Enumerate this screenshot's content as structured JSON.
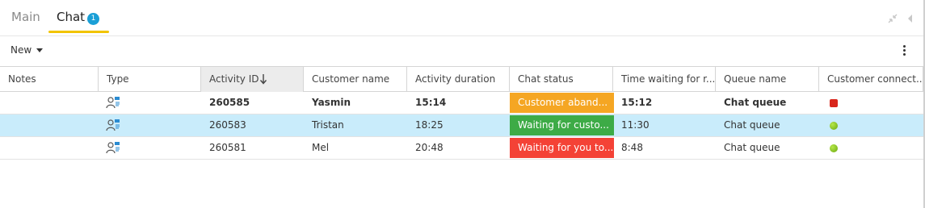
{
  "tabs": [
    {
      "label": "Main"
    },
    {
      "label": "Chat",
      "badge": "1"
    }
  ],
  "toolbar": {
    "new_label": "New"
  },
  "columns": [
    "Notes",
    "Type",
    "Activity ID",
    "Customer name",
    "Activity duration",
    "Chat status",
    "Time waiting for r...",
    "Queue name",
    "Customer connect..."
  ],
  "rows": [
    {
      "notes": "",
      "activity_id": "260585",
      "customer": "Yasmin",
      "duration": "15:14",
      "status": "Customer aband...",
      "status_color": "#f5a623",
      "waiting": "15:12",
      "queue": "Chat queue",
      "connection": "red"
    },
    {
      "notes": "",
      "activity_id": "260583",
      "customer": "Tristan",
      "duration": "18:25",
      "status": "Waiting for custo...",
      "status_color": "#3dab46",
      "waiting": "11:30",
      "queue": "Chat queue",
      "connection": "green"
    },
    {
      "notes": "",
      "activity_id": "260581",
      "customer": "Mel",
      "duration": "20:48",
      "status": "Waiting for you to...",
      "status_color": "#f44236",
      "waiting": "8:48",
      "queue": "Chat queue",
      "connection": "green"
    }
  ],
  "icons": {
    "type": "chat-person-icon",
    "sort": "arrow-down-icon",
    "collapse": "collapse-icon",
    "panel_toggle": "arrow-left-icon",
    "more": "more-vertical-icon"
  }
}
